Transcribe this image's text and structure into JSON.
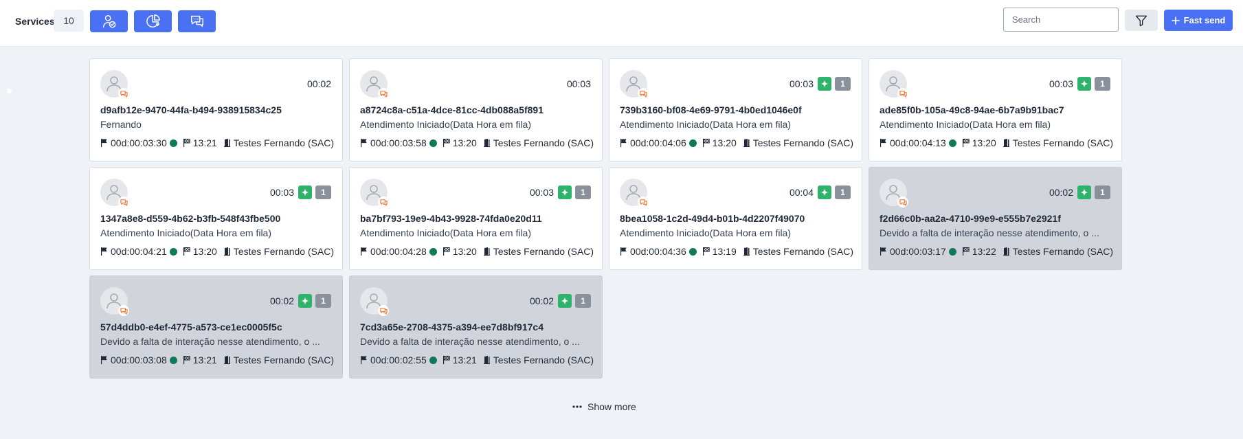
{
  "toolbar": {
    "services_label": "Services",
    "services_count": "10",
    "search_placeholder": "Search",
    "fast_send_label": "Fast send"
  },
  "cards": [
    {
      "time": "00:02",
      "badge": false,
      "count": "",
      "id": "d9afb12e-9470-44fa-b494-938915834c25",
      "subtitle": "Fernando",
      "duration": "00d:00:03:30",
      "finish_time": "13:21",
      "department": "Testes Fernando (SAC)",
      "dim": false
    },
    {
      "time": "00:03",
      "badge": false,
      "count": "",
      "id": "a8724c8a-c51a-4dce-81cc-4db088a5f891",
      "subtitle": "Atendimento Iniciado(Data Hora em fila)",
      "duration": "00d:00:03:58",
      "finish_time": "13:20",
      "department": "Testes Fernando (SAC)",
      "dim": false
    },
    {
      "time": "00:03",
      "badge": true,
      "count": "1",
      "id": "739b3160-bf08-4e69-9791-4b0ed1046e0f",
      "subtitle": "Atendimento Iniciado(Data Hora em fila)",
      "duration": "00d:00:04:06",
      "finish_time": "13:20",
      "department": "Testes Fernando (SAC)",
      "dim": false
    },
    {
      "time": "00:03",
      "badge": true,
      "count": "1",
      "id": "ade85f0b-105a-49c8-94ae-6b7a9b91bac7",
      "subtitle": "Atendimento Iniciado(Data Hora em fila)",
      "duration": "00d:00:04:13",
      "finish_time": "13:20",
      "department": "Testes Fernando (SAC)",
      "dim": false
    },
    {
      "time": "00:03",
      "badge": true,
      "count": "1",
      "id": "1347a8e8-d559-4b62-b3fb-548f43fbe500",
      "subtitle": "Atendimento Iniciado(Data Hora em fila)",
      "duration": "00d:00:04:21",
      "finish_time": "13:20",
      "department": "Testes Fernando (SAC)",
      "dim": false
    },
    {
      "time": "00:03",
      "badge": true,
      "count": "1",
      "id": "ba7bf793-19e9-4b43-9928-74fda0e20d11",
      "subtitle": "Atendimento Iniciado(Data Hora em fila)",
      "duration": "00d:00:04:28",
      "finish_time": "13:20",
      "department": "Testes Fernando (SAC)",
      "dim": false
    },
    {
      "time": "00:04",
      "badge": true,
      "count": "1",
      "id": "8bea1058-1c2d-49d4-b01b-4d2207f49070",
      "subtitle": "Atendimento Iniciado(Data Hora em fila)",
      "duration": "00d:00:04:36",
      "finish_time": "13:19",
      "department": "Testes Fernando (SAC)",
      "dim": false
    },
    {
      "time": "00:02",
      "badge": true,
      "count": "1",
      "id": "f2d66c0b-aa2a-4710-99e9-e555b7e2921f",
      "subtitle": "Devido a falta de interação nesse atendimento, o ...",
      "duration": "00d:00:03:17",
      "finish_time": "13:22",
      "department": "Testes Fernando (SAC)",
      "dim": true
    },
    {
      "time": "00:02",
      "badge": true,
      "count": "1",
      "id": "57d4ddb0-e4ef-4775-a573-ce1ec0005f5c",
      "subtitle": "Devido a falta de interação nesse atendimento, o ...",
      "duration": "00d:00:03:08",
      "finish_time": "13:21",
      "department": "Testes Fernando (SAC)",
      "dim": true
    },
    {
      "time": "00:02",
      "badge": true,
      "count": "1",
      "id": "7cd3a65e-2708-4375-a394-ee7d8bf917c4",
      "subtitle": "Devido a falta de interação nesse atendimento, o ...",
      "duration": "00d:00:02:55",
      "finish_time": "13:21",
      "department": "Testes Fernando (SAC)",
      "dim": true
    }
  ],
  "show_more_label": "Show more",
  "colors": {
    "primary": "#4a70f3",
    "status_green": "#0f7a58",
    "spark_green": "#2fb36b",
    "count_gray": "#8a919b",
    "dim_card": "#d1d5db",
    "chat_orange": "#f07a3a"
  }
}
